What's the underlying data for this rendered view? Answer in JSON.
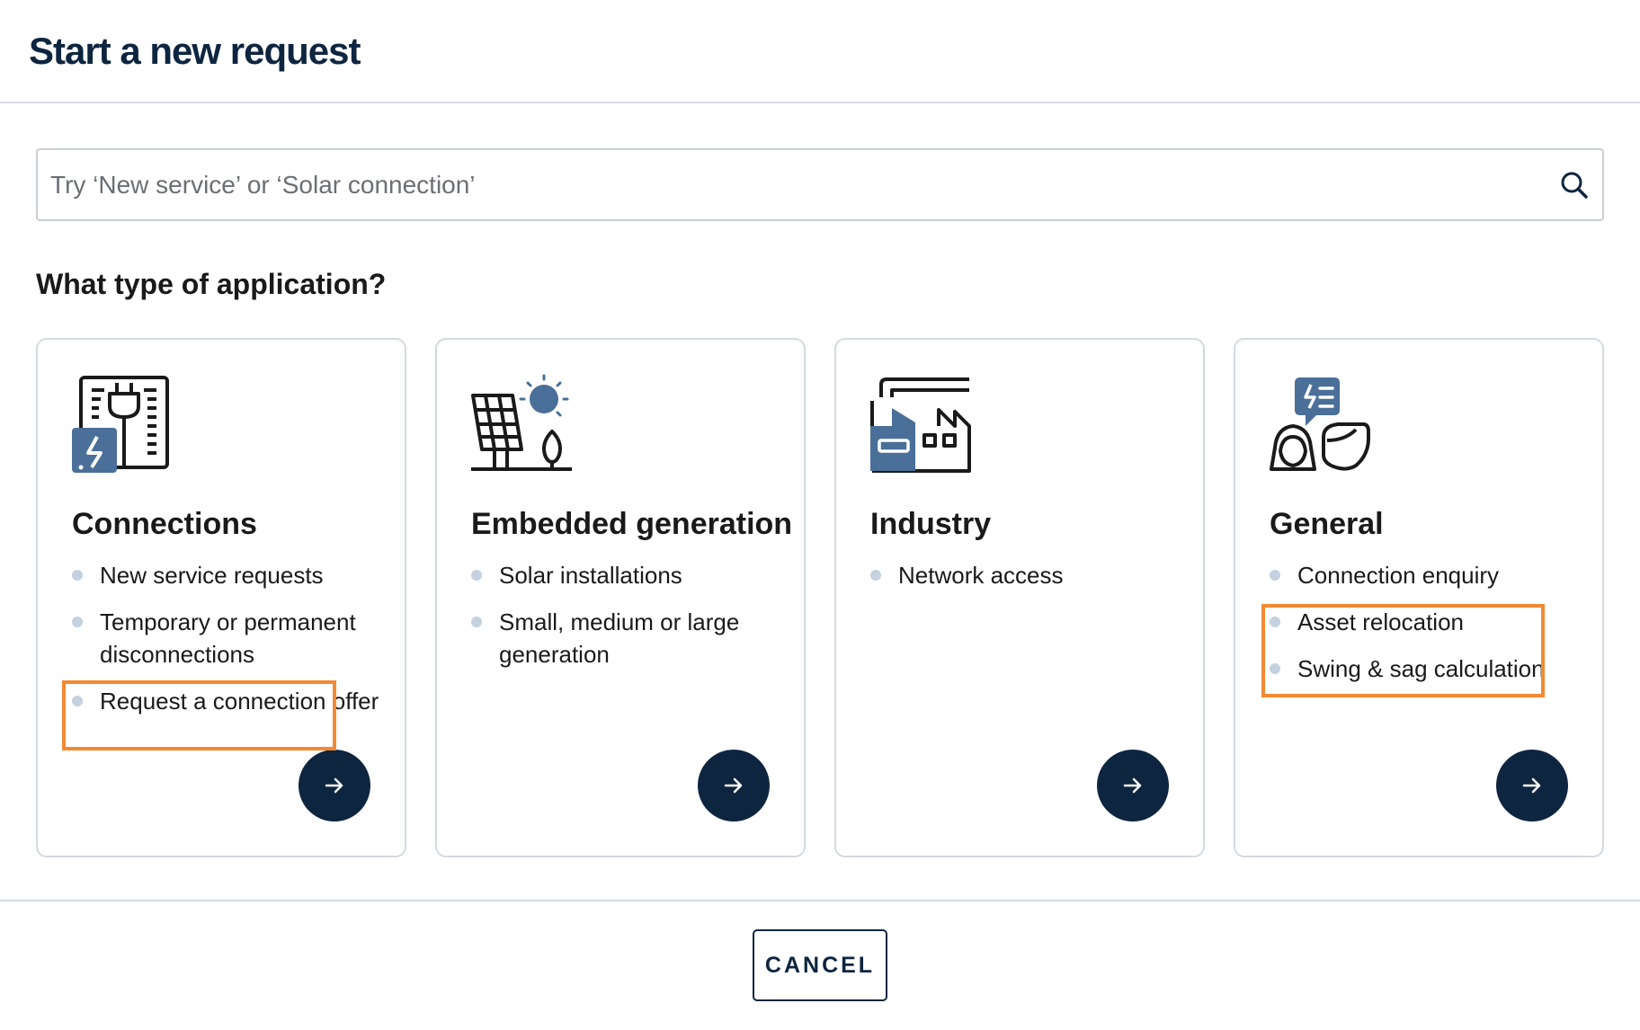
{
  "header": {
    "title": "Start a new request"
  },
  "search": {
    "placeholder": "Try ‘New service’ or ‘Solar connection’",
    "value": ""
  },
  "question": "What type of application?",
  "cards": [
    {
      "title": "Connections",
      "icon": "connections-plug-icon",
      "items": [
        "New service requests",
        "Temporary or permanent disconnections",
        "Request a connection offer"
      ]
    },
    {
      "title": "Embedded generation",
      "icon": "solar-panel-icon",
      "items": [
        "Solar installations",
        "Small, medium or large generation"
      ]
    },
    {
      "title": "Industry",
      "icon": "factory-icon",
      "items": [
        "Network access"
      ]
    },
    {
      "title": "General",
      "icon": "people-chat-icon",
      "items": [
        "Connection enquiry",
        "Asset relocation",
        "Swing & sag calculation"
      ]
    }
  ],
  "footer": {
    "cancel_label": "CANCEL"
  },
  "colors": {
    "navy": "#0e2540",
    "accent_blue": "#4a6f99",
    "bullet": "#c3d1e0",
    "border": "#d3dae2",
    "highlight": "#f28a33"
  }
}
